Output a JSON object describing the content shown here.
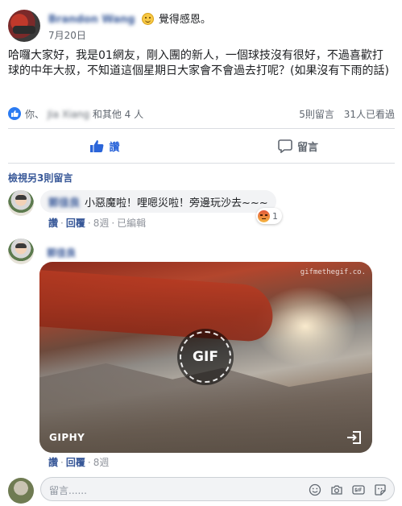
{
  "post": {
    "author": "Brandon Wang",
    "feeling": "覺得感恩。",
    "date": "7月20日",
    "body": "哈囉大家好，我是01網友，剛入團的新人，一個球技沒有很好，不過喜歡打球的中年大叔，不知道這個星期日大家會不會過去打呢？(如果沒有下雨的話)"
  },
  "stats": {
    "likers_prefix": "你、",
    "likers_name": "Jia Xiang",
    "likers_suffix": "和其他 4 人",
    "comments": "5則留言",
    "views": "31人已看過"
  },
  "actions": {
    "like": "讚",
    "comment": "留言"
  },
  "comments": {
    "view_more": "檢視另3則留言",
    "first": {
      "author": "郭佳良",
      "text": "小惡魔啦！哩嗯災啦！旁邊玩沙去~~~",
      "reaction_count": "1",
      "like": "讚",
      "reply": "回覆",
      "time": "8週",
      "edited": "已編輯"
    },
    "second": {
      "author": "郭佳良",
      "like": "讚",
      "reply": "回覆",
      "time": "8週",
      "gif_watermark": "gifmethegif.co.",
      "gif_badge": "GIF",
      "gif_source": "GIPHY"
    }
  },
  "composer": {
    "placeholder": "留言......"
  },
  "colors": {
    "link": "#385898",
    "like_active": "#2b65d9",
    "muted": "#606770"
  }
}
